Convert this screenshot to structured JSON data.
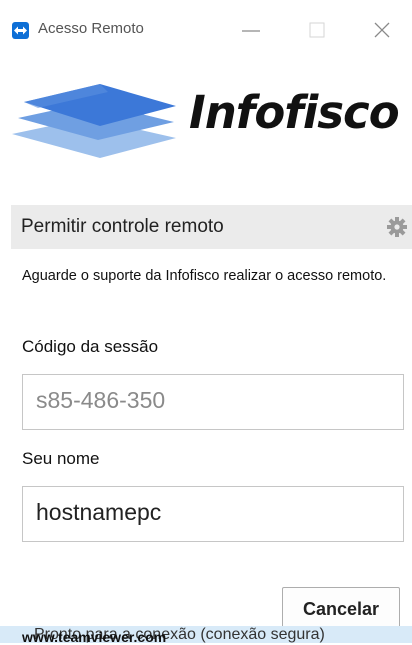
{
  "window": {
    "title": "Acesso Remoto",
    "controls": [
      "minimize",
      "maximize",
      "close"
    ]
  },
  "brand": {
    "name": "Infofisco",
    "accent": "#3c78d8",
    "icon": "teamviewer-icon"
  },
  "section": {
    "title": "Permitir controle remoto",
    "settings_icon": "gear-icon"
  },
  "info": "Aguarde o suporte da Infofisco realizar o acesso remoto.",
  "session_code": {
    "label": "Código da sessão",
    "value": "s85-486-350"
  },
  "user_name": {
    "label": "Seu nome",
    "value": "hostnamepc"
  },
  "buttons": {
    "cancel": "Cancelar"
  },
  "status": {
    "text": "Pronto para a conexão (conexão segura)",
    "url": "www.teamviewer.com"
  }
}
